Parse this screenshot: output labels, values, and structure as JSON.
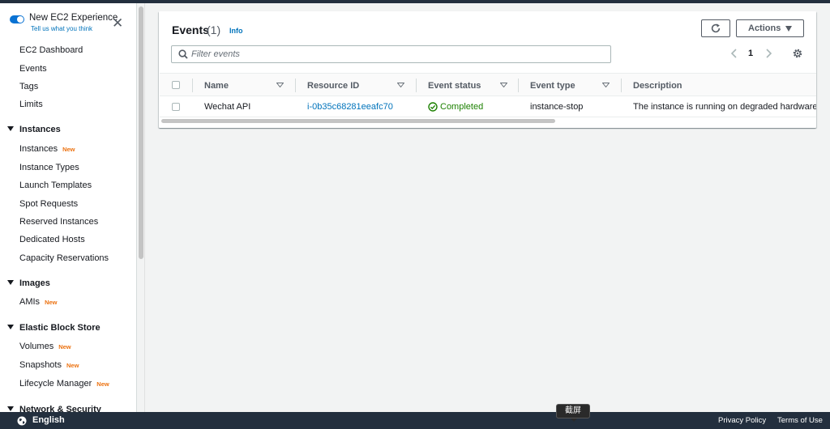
{
  "sidebar": {
    "experience": {
      "title": "New EC2 Experience",
      "subtitle": "Tell us what you think",
      "toggle_state": "on"
    },
    "links": [
      {
        "label": "EC2 Dashboard"
      },
      {
        "label": "Events"
      },
      {
        "label": "Tags"
      },
      {
        "label": "Limits"
      }
    ],
    "sections": [
      {
        "label": "Instances",
        "items": [
          {
            "label": "Instances",
            "badge": "New"
          },
          {
            "label": "Instance Types",
            "badge": ""
          },
          {
            "label": "Launch Templates",
            "badge": ""
          },
          {
            "label": "Spot Requests",
            "badge": ""
          },
          {
            "label": "Reserved Instances",
            "badge": ""
          },
          {
            "label": "Dedicated Hosts",
            "badge": ""
          },
          {
            "label": "Capacity Reservations",
            "badge": ""
          }
        ]
      },
      {
        "label": "Images",
        "items": [
          {
            "label": "AMIs",
            "badge": "New"
          }
        ]
      },
      {
        "label": "Elastic Block Store",
        "items": [
          {
            "label": "Volumes",
            "badge": "New"
          },
          {
            "label": "Snapshots",
            "badge": "New"
          },
          {
            "label": "Lifecycle Manager",
            "badge": "New"
          }
        ]
      },
      {
        "label": "Network & Security",
        "items": []
      }
    ]
  },
  "panel": {
    "title": "Events",
    "count": "(1)",
    "info": "Info",
    "actions_label": "Actions",
    "filter_placeholder": "Filter events",
    "filter_value": "",
    "page": "1",
    "columns": [
      "Name",
      "Resource ID",
      "Event status",
      "Event type",
      "Description"
    ],
    "rows": [
      {
        "name": "Wechat API",
        "resource_id": "i-0b35c68281eeafc70",
        "status": "Completed",
        "event_type": "instance-stop",
        "description": "The instance is running on degraded hardware"
      }
    ]
  },
  "footer": {
    "language": "English",
    "privacy": "Privacy Policy",
    "terms": "Terms of Use"
  },
  "tooltip": {
    "text": "截屏"
  },
  "icons": {
    "close": "close-icon",
    "refresh": "refresh-icon",
    "search": "search-icon",
    "settings": "gear-icon",
    "globe": "globe-icon",
    "status_ok": "check-circle-icon"
  },
  "colors": {
    "accent": "#0972d3",
    "link": "#0073bb",
    "success": "#1d8102",
    "badge": "#ec7211",
    "footer": "#232f3e"
  }
}
